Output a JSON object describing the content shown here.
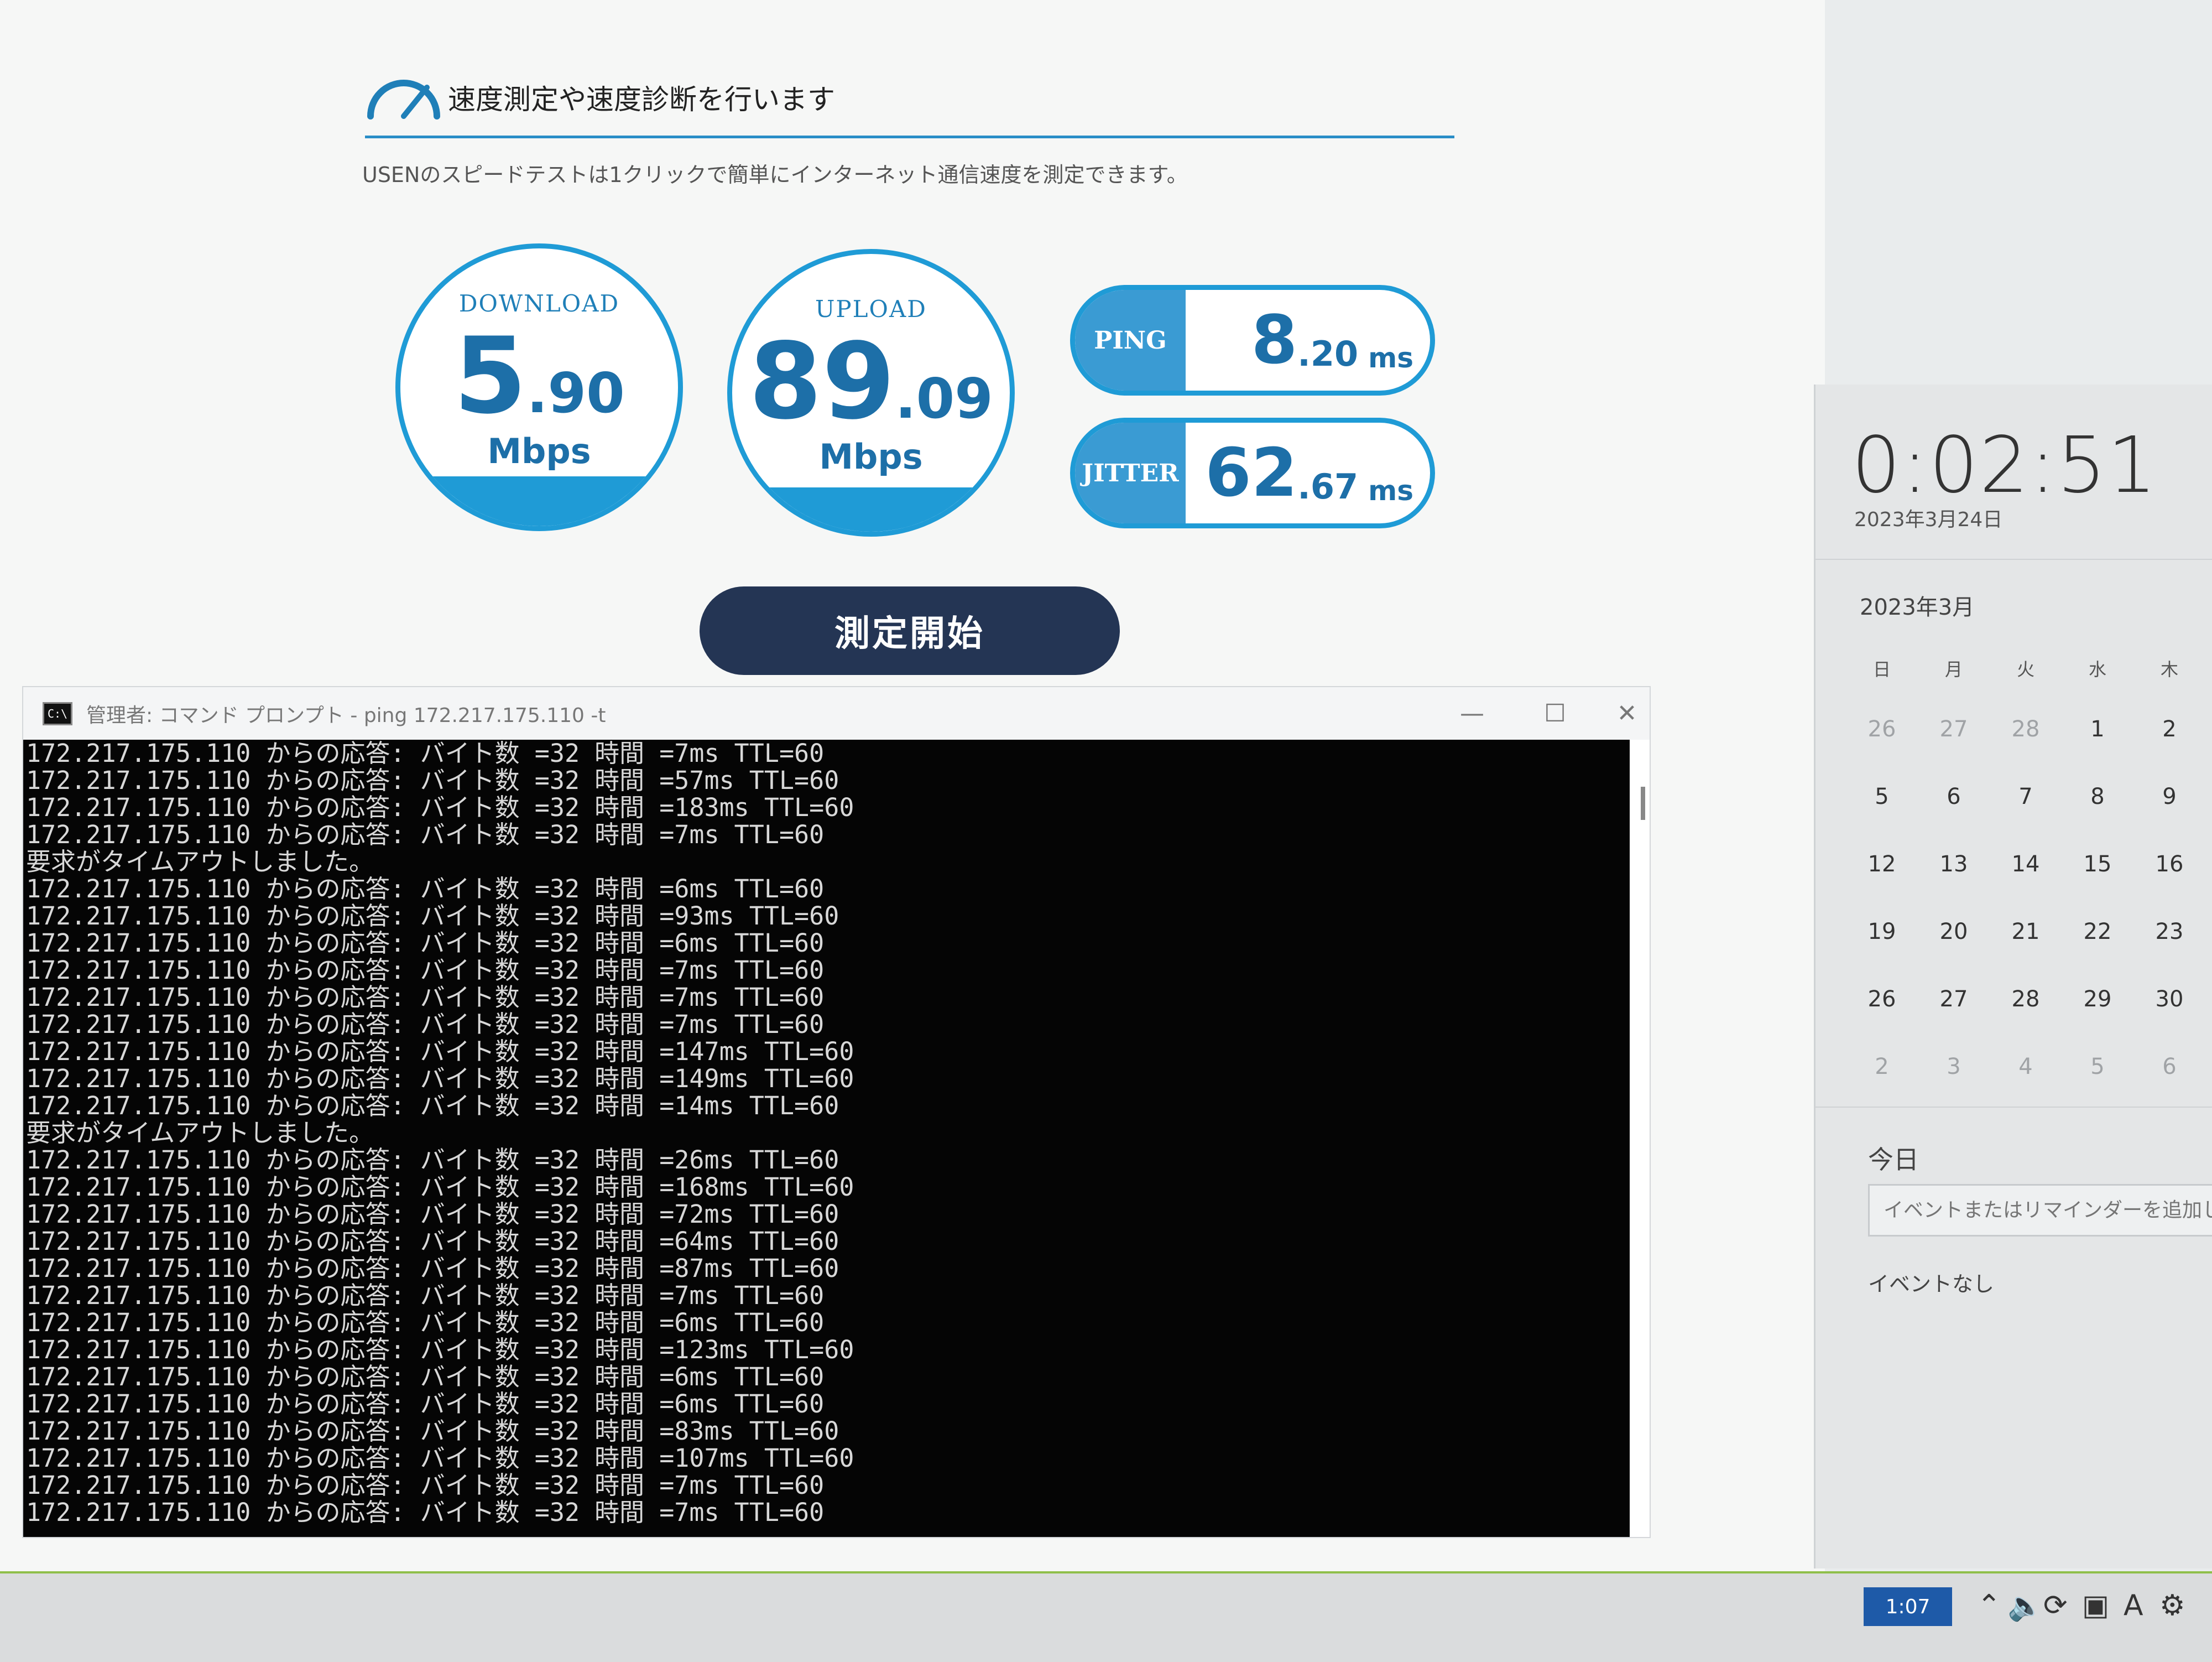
{
  "speed_test": {
    "title": "速度測定や速度診断を行います",
    "subtitle": "USENのスピードテストは1クリックで簡単にインターネット通信速度を測定できます。",
    "download": {
      "label": "DOWNLOAD",
      "int": "5",
      "dec": ".90",
      "unit": "Mbps",
      "fill_fraction": 0.18
    },
    "upload": {
      "label": "UPLOAD",
      "int": "89",
      "dec": ".09",
      "unit": "Mbps",
      "fill_fraction": 0.16
    },
    "ping": {
      "label": "PING",
      "int": "8",
      "dec": ".20",
      "unit": "ms"
    },
    "jitter": {
      "label": "JITTER",
      "int": "62",
      "dec": ".67",
      "unit": "ms"
    },
    "start_label": "測定開始",
    "colors": {
      "accent": "#1f9bd6",
      "button": "#243554"
    }
  },
  "cmd": {
    "title": "管理者: コマンド プロンプト - ping  172.217.175.110 -t",
    "lines": [
      "172.217.175.110 からの応答: バイト数 =32 時間 =7ms TTL=60",
      "172.217.175.110 からの応答: バイト数 =32 時間 =57ms TTL=60",
      "172.217.175.110 からの応答: バイト数 =32 時間 =183ms TTL=60",
      "172.217.175.110 からの応答: バイト数 =32 時間 =7ms TTL=60",
      "要求がタイムアウトしました。",
      "172.217.175.110 からの応答: バイト数 =32 時間 =6ms TTL=60",
      "172.217.175.110 からの応答: バイト数 =32 時間 =93ms TTL=60",
      "172.217.175.110 からの応答: バイト数 =32 時間 =6ms TTL=60",
      "172.217.175.110 からの応答: バイト数 =32 時間 =7ms TTL=60",
      "172.217.175.110 からの応答: バイト数 =32 時間 =7ms TTL=60",
      "172.217.175.110 からの応答: バイト数 =32 時間 =7ms TTL=60",
      "172.217.175.110 からの応答: バイト数 =32 時間 =147ms TTL=60",
      "172.217.175.110 からの応答: バイト数 =32 時間 =149ms TTL=60",
      "172.217.175.110 からの応答: バイト数 =32 時間 =14ms TTL=60",
      "要求がタイムアウトしました。",
      "172.217.175.110 からの応答: バイト数 =32 時間 =26ms TTL=60",
      "172.217.175.110 からの応答: バイト数 =32 時間 =168ms TTL=60",
      "172.217.175.110 からの応答: バイト数 =32 時間 =72ms TTL=60",
      "172.217.175.110 からの応答: バイト数 =32 時間 =64ms TTL=60",
      "172.217.175.110 からの応答: バイト数 =32 時間 =87ms TTL=60",
      "172.217.175.110 からの応答: バイト数 =32 時間 =7ms TTL=60",
      "172.217.175.110 からの応答: バイト数 =32 時間 =6ms TTL=60",
      "172.217.175.110 からの応答: バイト数 =32 時間 =123ms TTL=60",
      "172.217.175.110 からの応答: バイト数 =32 時間 =6ms TTL=60",
      "172.217.175.110 からの応答: バイト数 =32 時間 =6ms TTL=60",
      "172.217.175.110 からの応答: バイト数 =32 時間 =83ms TTL=60",
      "172.217.175.110 からの応答: バイト数 =32 時間 =107ms TTL=60",
      "172.217.175.110 からの応答: バイト数 =32 時間 =7ms TTL=60",
      "172.217.175.110 からの応答: バイト数 =32 時間 =7ms TTL=60"
    ]
  },
  "flyout": {
    "clock": "0:02:51",
    "date": "2023年3月24日",
    "month": "2023年3月",
    "weekdays": [
      "日",
      "月",
      "火",
      "水",
      "木"
    ],
    "weeks": [
      [
        {
          "d": "26",
          "dim": true
        },
        {
          "d": "27",
          "dim": true
        },
        {
          "d": "28",
          "dim": true
        },
        {
          "d": "1"
        },
        {
          "d": "2"
        }
      ],
      [
        {
          "d": "5"
        },
        {
          "d": "6"
        },
        {
          "d": "7"
        },
        {
          "d": "8"
        },
        {
          "d": "9"
        }
      ],
      [
        {
          "d": "12"
        },
        {
          "d": "13"
        },
        {
          "d": "14"
        },
        {
          "d": "15"
        },
        {
          "d": "16"
        }
      ],
      [
        {
          "d": "19"
        },
        {
          "d": "20"
        },
        {
          "d": "21"
        },
        {
          "d": "22"
        },
        {
          "d": "23"
        }
      ],
      [
        {
          "d": "26"
        },
        {
          "d": "27"
        },
        {
          "d": "28"
        },
        {
          "d": "29"
        },
        {
          "d": "30"
        }
      ],
      [
        {
          "d": "2",
          "dim": true
        },
        {
          "d": "3",
          "dim": true
        },
        {
          "d": "4",
          "dim": true
        },
        {
          "d": "5",
          "dim": true
        },
        {
          "d": "6",
          "dim": true
        }
      ]
    ],
    "today_label": "今日",
    "event_placeholder": "イベントまたはリマインダーを追加します",
    "no_events": "イベントなし"
  },
  "taskbar": {
    "time": "1:07",
    "icons": [
      "chevron-up-icon",
      "speaker-muted-icon",
      "sync-icon",
      "network-icon",
      "ime-icon",
      "gear-icon"
    ],
    "ime_label": "A"
  }
}
